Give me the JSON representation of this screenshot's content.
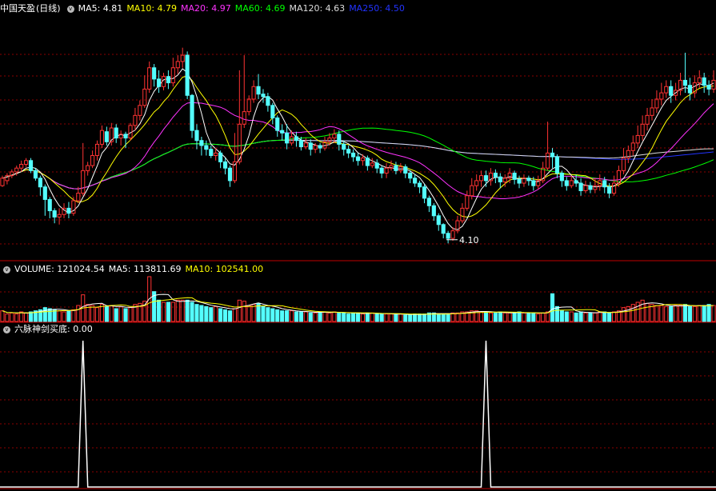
{
  "header": {
    "stock_name": "中国天盈",
    "period": "(日线)",
    "ma": [
      {
        "label": "MA5: 4.81",
        "color": "#ffffff"
      },
      {
        "label": "MA10: 4.79",
        "color": "#ffff00"
      },
      {
        "label": "MA20: 4.97",
        "color": "#ff33ff"
      },
      {
        "label": "MA60: 4.69",
        "color": "#00ff00"
      },
      {
        "label": "MA120: 4.63",
        "color": "#dddddd"
      },
      {
        "label": "MA250: 4.50",
        "color": "#2233ff"
      }
    ]
  },
  "volume_header": {
    "volume": "VOLUME: 121024.54",
    "ma5": "MA5: 113811.69",
    "ma10": "MA10: 102541.00",
    "ma10_color": "#ffff00"
  },
  "indicator_header": {
    "name": "六脉神剑买底",
    "value": ": 0.00"
  },
  "colors": {
    "up": "#ff3333",
    "down": "#54ffff",
    "grid": "#8b0000",
    "divider": "#c00000"
  },
  "chart_data": {
    "type": "candlestick",
    "price_range": [
      4.0,
      5.9
    ],
    "low_annotation": "4.10",
    "low_annotation_index": 96,
    "candles": [
      [
        4.56,
        4.62,
        4.55,
        4.64
      ],
      [
        4.6,
        4.64,
        4.57,
        4.66
      ],
      [
        4.64,
        4.67,
        4.62,
        4.69
      ],
      [
        4.67,
        4.7,
        4.64,
        4.72
      ],
      [
        4.7,
        4.73,
        4.67,
        4.76
      ],
      [
        4.73,
        4.76,
        4.71,
        4.78
      ],
      [
        4.76,
        4.68,
        4.66,
        4.78
      ],
      [
        4.68,
        4.62,
        4.6,
        4.7
      ],
      [
        4.62,
        4.55,
        4.48,
        4.64
      ],
      [
        4.55,
        4.45,
        4.32,
        4.57
      ],
      [
        4.45,
        4.36,
        4.3,
        4.47
      ],
      [
        4.36,
        4.31,
        4.26,
        4.38
      ],
      [
        4.31,
        4.33,
        4.25,
        4.38
      ],
      [
        4.33,
        4.38,
        4.3,
        4.42
      ],
      [
        4.38,
        4.34,
        4.3,
        4.43
      ],
      [
        4.34,
        4.44,
        4.32,
        4.47
      ],
      [
        4.44,
        4.5,
        4.42,
        4.55
      ],
      [
        4.5,
        4.68,
        4.48,
        4.9
      ],
      [
        4.68,
        4.72,
        4.64,
        4.75
      ],
      [
        4.72,
        4.8,
        4.7,
        4.84
      ],
      [
        4.8,
        4.89,
        4.76,
        4.92
      ],
      [
        4.89,
        5.0,
        4.86,
        5.04
      ],
      [
        4.99,
        4.91,
        4.88,
        5.03
      ],
      [
        4.91,
        5.02,
        4.88,
        5.06
      ],
      [
        5.02,
        4.94,
        4.9,
        5.05
      ],
      [
        4.94,
        4.97,
        4.88,
        5.0
      ],
      [
        4.97,
        4.94,
        4.86,
        4.99
      ],
      [
        4.94,
        5.04,
        4.92,
        5.06
      ],
      [
        5.04,
        5.12,
        5.0,
        5.18
      ],
      [
        5.12,
        5.2,
        5.08,
        5.24
      ],
      [
        5.2,
        5.33,
        5.18,
        5.44
      ],
      [
        5.33,
        5.5,
        5.3,
        5.55
      ],
      [
        5.5,
        5.41,
        5.35,
        5.53
      ],
      [
        5.41,
        5.35,
        5.3,
        5.48
      ],
      [
        5.35,
        5.43,
        5.32,
        5.46
      ],
      [
        5.43,
        5.38,
        5.33,
        5.48
      ],
      [
        5.38,
        5.5,
        5.35,
        5.58
      ],
      [
        5.5,
        5.55,
        5.45,
        5.6
      ],
      [
        5.55,
        5.6,
        5.5,
        5.66
      ],
      [
        5.6,
        5.28,
        5.25,
        5.63
      ],
      [
        5.28,
        5.0,
        4.94,
        5.29
      ],
      [
        5.0,
        4.92,
        4.85,
        5.05
      ],
      [
        4.92,
        4.88,
        4.8,
        4.95
      ],
      [
        4.88,
        4.85,
        4.8,
        4.92
      ],
      [
        4.85,
        4.8,
        4.78,
        4.88
      ],
      [
        4.8,
        4.82,
        4.76,
        4.86
      ],
      [
        4.82,
        4.75,
        4.7,
        4.84
      ],
      [
        4.75,
        4.7,
        4.65,
        4.78
      ],
      [
        4.7,
        4.6,
        4.55,
        4.72
      ],
      [
        4.6,
        4.75,
        4.58,
        4.98
      ],
      [
        4.75,
        5.05,
        4.73,
        5.48
      ],
      [
        5.05,
        5.15,
        5.02,
        5.6
      ],
      [
        5.15,
        5.25,
        5.12,
        5.28
      ],
      [
        5.25,
        5.35,
        5.22,
        5.4
      ],
      [
        5.35,
        5.29,
        5.25,
        5.45
      ],
      [
        5.29,
        5.27,
        5.22,
        5.33
      ],
      [
        5.27,
        5.2,
        5.15,
        5.3
      ],
      [
        5.2,
        5.1,
        5.05,
        5.22
      ],
      [
        5.1,
        5.0,
        4.95,
        5.12
      ],
      [
        5.0,
        4.98,
        4.92,
        5.05
      ],
      [
        4.98,
        4.9,
        4.85,
        5.05
      ],
      [
        4.9,
        4.95,
        4.88,
        5.0
      ],
      [
        4.95,
        4.92,
        4.87,
        4.99
      ],
      [
        4.92,
        4.87,
        4.84,
        4.95
      ],
      [
        4.87,
        4.9,
        4.85,
        4.94
      ],
      [
        4.9,
        4.85,
        4.8,
        4.93
      ],
      [
        4.85,
        4.88,
        4.82,
        4.9
      ],
      [
        4.88,
        4.86,
        4.82,
        4.9
      ],
      [
        4.86,
        4.91,
        4.84,
        4.95
      ],
      [
        4.91,
        4.94,
        4.88,
        4.98
      ],
      [
        4.94,
        4.97,
        4.9,
        5.01
      ],
      [
        4.97,
        4.89,
        4.84,
        5.0
      ],
      [
        4.89,
        4.85,
        4.8,
        4.92
      ],
      [
        4.85,
        4.82,
        4.78,
        4.88
      ],
      [
        4.82,
        4.79,
        4.75,
        4.85
      ],
      [
        4.79,
        4.76,
        4.72,
        4.82
      ],
      [
        4.76,
        4.78,
        4.72,
        4.81
      ],
      [
        4.78,
        4.72,
        4.68,
        4.8
      ],
      [
        4.72,
        4.74,
        4.7,
        4.78
      ],
      [
        4.74,
        4.7,
        4.66,
        4.77
      ],
      [
        4.7,
        4.66,
        4.62,
        4.72
      ],
      [
        4.66,
        4.7,
        4.62,
        4.74
      ],
      [
        4.7,
        4.72,
        4.68,
        4.76
      ],
      [
        4.72,
        4.68,
        4.65,
        4.75
      ],
      [
        4.68,
        4.71,
        4.66,
        4.74
      ],
      [
        4.71,
        4.66,
        4.62,
        4.73
      ],
      [
        4.66,
        4.62,
        4.58,
        4.68
      ],
      [
        4.62,
        4.58,
        4.55,
        4.65
      ],
      [
        4.58,
        4.55,
        4.5,
        4.6
      ],
      [
        4.55,
        4.46,
        4.42,
        4.57
      ],
      [
        4.46,
        4.4,
        4.35,
        4.48
      ],
      [
        4.4,
        4.32,
        4.28,
        4.42
      ],
      [
        4.32,
        4.25,
        4.2,
        4.34
      ],
      [
        4.25,
        4.18,
        4.14,
        4.26
      ],
      [
        4.18,
        4.14,
        4.1,
        4.2
      ],
      [
        4.14,
        4.2,
        4.12,
        4.23
      ],
      [
        4.2,
        4.28,
        4.18,
        4.32
      ],
      [
        4.28,
        4.38,
        4.26,
        4.42
      ],
      [
        4.38,
        4.48,
        4.36,
        4.52
      ],
      [
        4.48,
        4.56,
        4.45,
        4.62
      ],
      [
        4.56,
        4.6,
        4.52,
        4.65
      ],
      [
        4.6,
        4.64,
        4.55,
        4.68
      ],
      [
        4.64,
        4.6,
        4.55,
        4.68
      ],
      [
        4.6,
        4.66,
        4.56,
        4.7
      ],
      [
        4.66,
        4.63,
        4.58,
        4.69
      ],
      [
        4.63,
        4.59,
        4.54,
        4.66
      ],
      [
        4.59,
        4.62,
        4.55,
        4.65
      ],
      [
        4.62,
        4.66,
        4.58,
        4.7
      ],
      [
        4.66,
        4.61,
        4.57,
        4.68
      ],
      [
        4.61,
        4.58,
        4.54,
        4.64
      ],
      [
        4.58,
        4.62,
        4.55,
        4.65
      ],
      [
        4.62,
        4.6,
        4.56,
        4.64
      ],
      [
        4.6,
        4.56,
        4.52,
        4.63
      ],
      [
        4.56,
        4.6,
        4.53,
        4.64
      ],
      [
        4.6,
        4.7,
        4.58,
        4.75
      ],
      [
        4.7,
        4.82,
        4.68,
        5.07
      ],
      [
        4.82,
        4.79,
        4.7,
        4.86
      ],
      [
        4.79,
        4.66,
        4.62,
        4.81
      ],
      [
        4.66,
        4.6,
        4.55,
        4.68
      ],
      [
        4.6,
        4.56,
        4.52,
        4.63
      ],
      [
        4.56,
        4.6,
        4.54,
        4.64
      ],
      [
        4.6,
        4.58,
        4.55,
        4.65
      ],
      [
        4.58,
        4.52,
        4.48,
        4.62
      ],
      [
        4.52,
        4.56,
        4.5,
        4.6
      ],
      [
        4.56,
        4.53,
        4.5,
        4.59
      ],
      [
        4.53,
        4.56,
        4.5,
        4.62
      ],
      [
        4.56,
        4.6,
        4.52,
        4.65
      ],
      [
        4.6,
        4.55,
        4.5,
        4.63
      ],
      [
        4.55,
        4.5,
        4.46,
        4.58
      ],
      [
        4.5,
        4.58,
        4.48,
        4.64
      ],
      [
        4.58,
        4.68,
        4.55,
        4.72
      ],
      [
        4.68,
        4.78,
        4.65,
        4.86
      ],
      [
        4.78,
        4.84,
        4.74,
        4.88
      ],
      [
        4.84,
        4.9,
        4.8,
        4.96
      ],
      [
        4.9,
        4.96,
        4.86,
        5.04
      ],
      [
        4.96,
        5.05,
        4.92,
        5.12
      ],
      [
        5.05,
        5.12,
        5.0,
        5.18
      ],
      [
        5.12,
        5.18,
        5.08,
        5.25
      ],
      [
        5.18,
        5.25,
        5.14,
        5.32
      ],
      [
        5.25,
        5.3,
        5.2,
        5.38
      ],
      [
        5.3,
        5.35,
        5.26,
        5.4
      ],
      [
        5.35,
        5.28,
        5.22,
        5.4
      ],
      [
        5.28,
        5.32,
        5.24,
        5.38
      ],
      [
        5.32,
        5.4,
        5.28,
        5.46
      ],
      [
        5.4,
        5.36,
        5.3,
        5.62
      ],
      [
        5.36,
        5.3,
        5.24,
        5.42
      ],
      [
        5.3,
        5.38,
        5.26,
        5.44
      ],
      [
        5.38,
        5.42,
        5.34,
        5.48
      ],
      [
        5.42,
        5.36,
        5.3,
        5.46
      ],
      [
        5.36,
        5.33,
        5.28,
        5.4
      ],
      [
        5.33,
        5.4,
        5.3,
        5.48
      ]
    ],
    "volume": [
      1.0,
      0.7,
      0.8,
      0.7,
      0.9,
      0.8,
      0.9,
      1.0,
      1.1,
      1.3,
      1.2,
      1.1,
      1.0,
      0.9,
      1.0,
      1.1,
      1.5,
      2.5,
      1.6,
      1.5,
      1.3,
      1.6,
      1.4,
      1.5,
      1.2,
      1.4,
      1.2,
      1.3,
      1.6,
      1.7,
      1.9,
      4.2,
      2.8,
      2.0,
      1.8,
      1.8,
      1.8,
      2.0,
      2.0,
      2.0,
      1.8,
      1.6,
      1.5,
      1.4,
      1.3,
      1.4,
      1.2,
      1.1,
      1.0,
      1.2,
      2.0,
      1.9,
      1.5,
      1.6,
      1.7,
      1.4,
      1.3,
      1.2,
      1.1,
      1.0,
      1.0,
      1.0,
      0.9,
      0.9,
      0.9,
      0.8,
      0.8,
      0.9,
      0.9,
      0.8,
      0.9,
      0.8,
      0.8,
      0.7,
      0.8,
      0.8,
      0.7,
      0.8,
      0.8,
      0.7,
      0.7,
      0.7,
      0.7,
      0.7,
      0.7,
      0.6,
      0.6,
      0.7,
      0.7,
      0.7,
      0.8,
      0.8,
      0.7,
      0.7,
      0.7,
      0.8,
      0.8,
      0.9,
      0.9,
      1.0,
      1.0,
      0.9,
      0.9,
      0.8,
      0.8,
      0.9,
      0.8,
      0.8,
      0.8,
      0.9,
      0.8,
      0.8,
      0.8,
      0.7,
      0.8,
      0.9,
      2.6,
      1.4,
      1.0,
      0.9,
      0.9,
      0.8,
      0.9,
      0.8,
      0.8,
      0.8,
      0.9,
      0.9,
      0.8,
      0.9,
      1.0,
      1.3,
      1.4,
      1.6,
      1.8,
      2.0,
      1.7,
      1.6,
      1.5,
      1.5,
      1.4,
      1.4,
      1.5,
      1.5,
      1.6,
      1.4,
      1.4,
      1.5,
      1.5,
      1.6,
      1.5
    ],
    "signal_peaks": [
      17,
      102
    ]
  }
}
